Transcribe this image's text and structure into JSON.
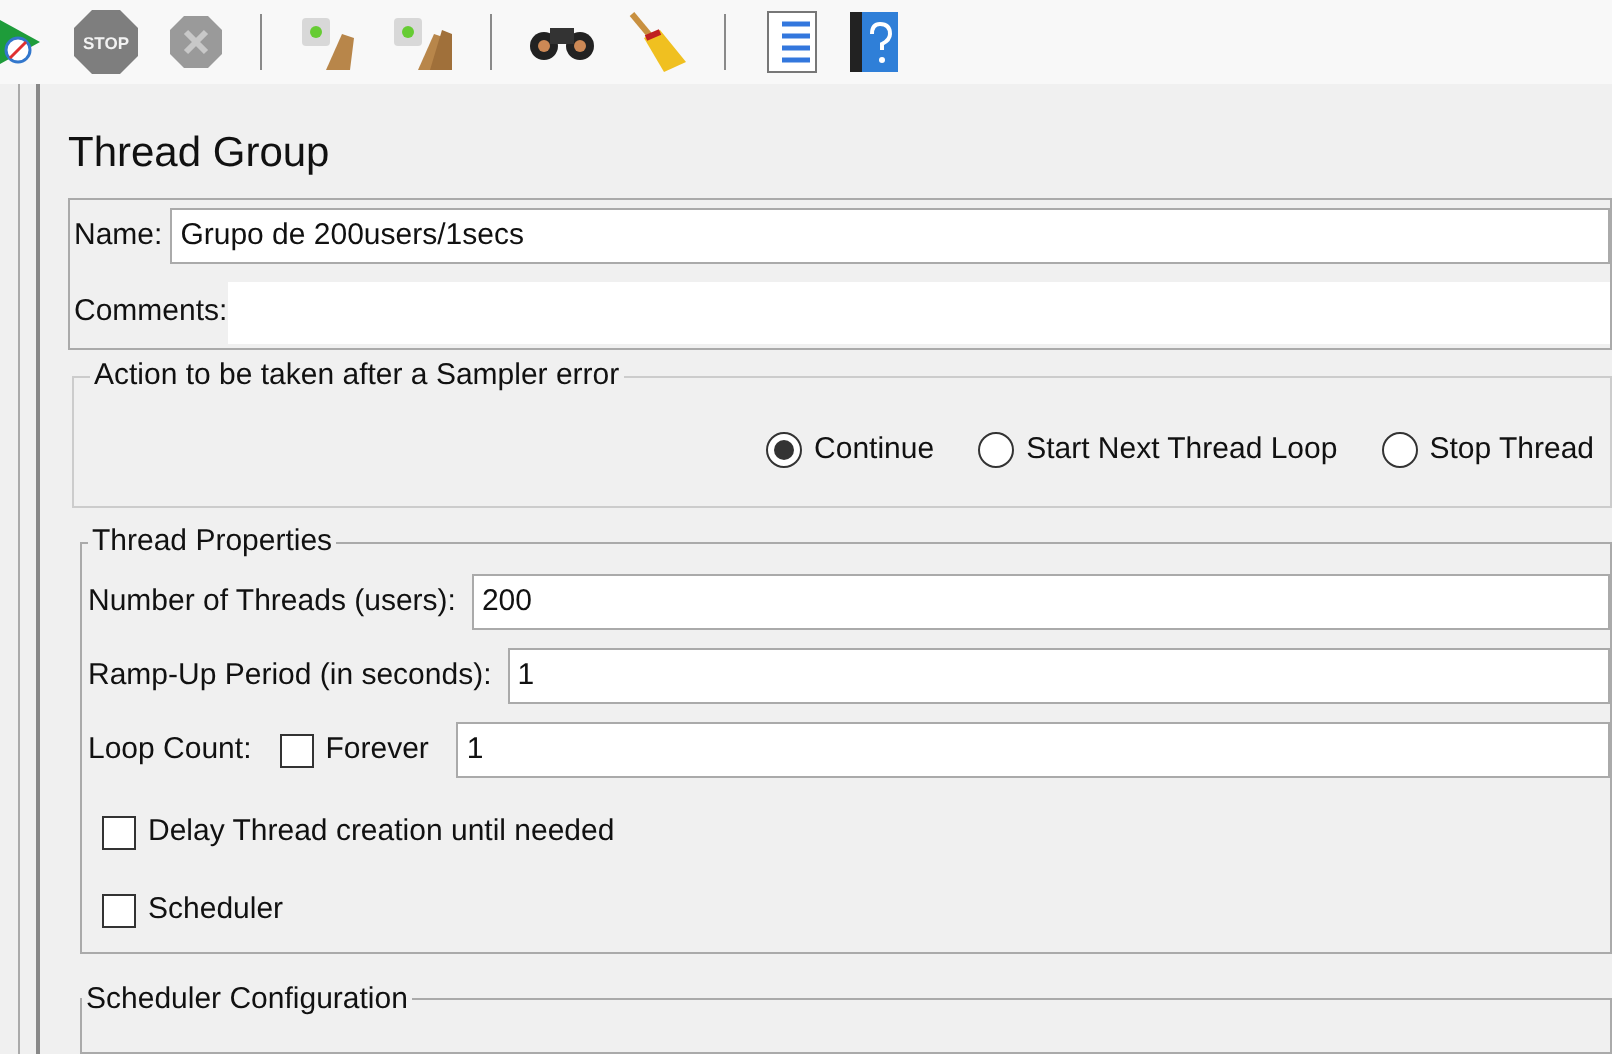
{
  "toolbar": [
    {
      "kind": "start"
    },
    {
      "kind": "stop",
      "label": "STOP"
    },
    {
      "kind": "shutdown"
    },
    {
      "kind": "separator"
    },
    {
      "kind": "clear"
    },
    {
      "kind": "clear_all"
    },
    {
      "kind": "separator"
    },
    {
      "kind": "search"
    },
    {
      "kind": "reset"
    },
    {
      "kind": "separator"
    },
    {
      "kind": "function_list"
    },
    {
      "kind": "help"
    }
  ],
  "panel": {
    "title": "Thread Group",
    "name": {
      "label": "Name:",
      "value": "Grupo de 200users/1secs"
    },
    "comments": {
      "label": "Comments:"
    },
    "sampler_error": {
      "legend": "Action to be taken after a Sampler error",
      "options": [
        {
          "label": "Continue",
          "selected": true
        },
        {
          "label": "Start Next Thread Loop",
          "selected": false
        },
        {
          "label": "Stop Thread",
          "selected": false
        }
      ]
    },
    "thread_properties": {
      "legend": "Thread Properties",
      "threads": {
        "label": "Number of Threads (users):",
        "value": "200"
      },
      "ramp_up": {
        "label": "Ramp-Up Period (in seconds):",
        "value": "1"
      },
      "loop_count": {
        "label": "Loop Count:",
        "forever": {
          "label": "Forever",
          "checked": false
        },
        "value": "1"
      },
      "options": [
        {
          "label": "Delay Thread creation until needed",
          "checked": false
        },
        {
          "label": "Scheduler",
          "checked": false
        }
      ]
    },
    "scheduler_configuration": {
      "legend": "Scheduler Configuration"
    }
  }
}
